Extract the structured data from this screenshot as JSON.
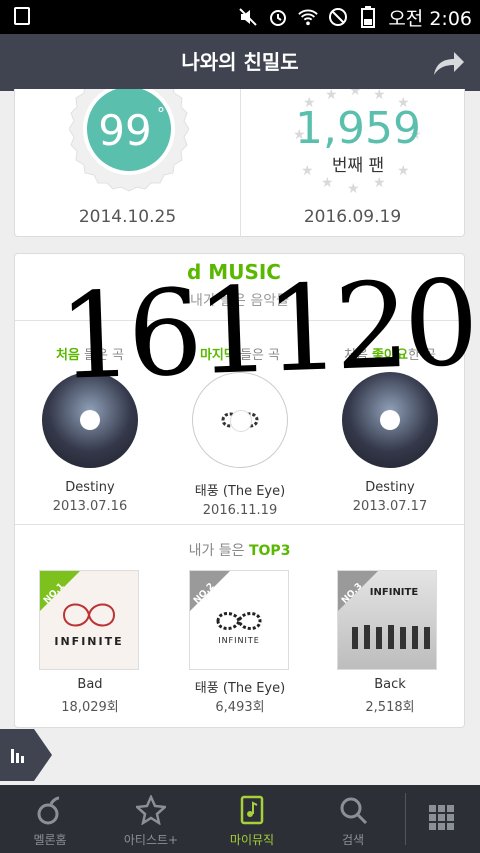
{
  "status": {
    "clock": "오전 2:06"
  },
  "header": {
    "title": "나와의 친밀도"
  },
  "intimacy": {
    "score": "99",
    "score_mark": "°",
    "first_date": "2014.10.25",
    "fan_number": "1,959",
    "fan_label": "번째 팬",
    "fan_date": "2016.09.19"
  },
  "handwriting": "161120",
  "music": {
    "brand": "MUSIC",
    "brand_prefix": "d",
    "subtitle": "내가 들은 음악들",
    "columns": [
      {
        "head_pre": "",
        "head_hl": "처음",
        "head_post": " 들은 곡",
        "song": "Destiny",
        "date": "2013.07.16"
      },
      {
        "head_pre": "",
        "head_hl": "마지막",
        "head_post": " 들은 곡",
        "song": "태풍 (The Eye)",
        "date": "2016.11.19"
      },
      {
        "head_pre": "처음 ",
        "head_hl": "좋아요",
        "head_post": "한 곡",
        "song": "Destiny",
        "date": "2013.07.17"
      }
    ]
  },
  "top3": {
    "title_pre": "내가 들은 ",
    "title_hl": "TOP3",
    "items": [
      {
        "rank": "NO.1",
        "name": "Bad",
        "count": "18,029회",
        "album_text": "INFINITE"
      },
      {
        "rank": "NO.2",
        "name": "태풍 (The Eye)",
        "count": "6,493회",
        "album_text": "INFINITE"
      },
      {
        "rank": "NO.3",
        "name": "Back",
        "count": "2,518회",
        "album_text": "INFINITE"
      }
    ]
  },
  "tabs": [
    {
      "label": "멜론홈",
      "icon": "note-icon"
    },
    {
      "label": "아티스트+",
      "icon": "star-icon"
    },
    {
      "label": "마이뮤직",
      "icon": "my-music-icon",
      "active": true
    },
    {
      "label": "검색",
      "icon": "search-icon"
    },
    {
      "label": "",
      "icon": "grid-menu-icon"
    }
  ],
  "colors": {
    "accent": "#5ab800",
    "teal": "#5bbfad",
    "header_bg": "#3f4450",
    "tabbar_bg": "#2c2f36"
  }
}
